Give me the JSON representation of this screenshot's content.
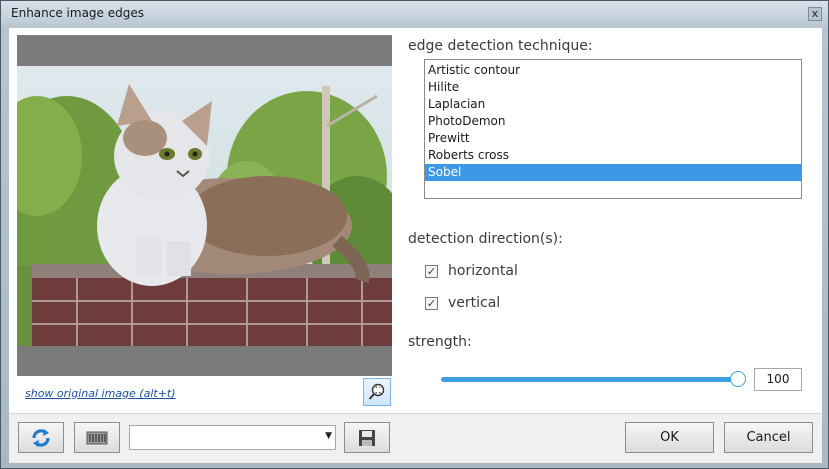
{
  "window": {
    "title": "Enhance image edges",
    "close_glyph": "x"
  },
  "preview": {
    "show_original_link": "show original image (alt+t)"
  },
  "technique": {
    "label": "edge detection technique:",
    "items": [
      "Artistic contour",
      "Hilite",
      "Laplacian",
      "PhotoDemon",
      "Prewitt",
      "Roberts cross",
      "Sobel"
    ],
    "selected": "Sobel"
  },
  "direction": {
    "label": "detection direction(s):",
    "horizontal": {
      "label": "horizontal",
      "checked": true
    },
    "vertical": {
      "label": "vertical",
      "checked": true
    }
  },
  "strength": {
    "label": "strength:",
    "value": "100",
    "fraction": 1.0
  },
  "footer": {
    "ok_label": "OK",
    "cancel_label": "Cancel",
    "preset_value": ""
  },
  "icons": [
    "close-icon",
    "zoom-fit-icon",
    "reset-icon",
    "randomize-icon",
    "save-preset-icon",
    "dropdown-arrow-icon"
  ],
  "colors": {
    "selection": "#3e98e8",
    "slider": "#3d9ddf",
    "link": "#1f4fa0"
  }
}
